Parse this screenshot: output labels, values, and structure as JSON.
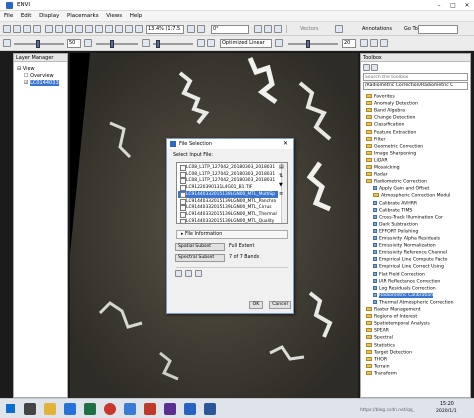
{
  "window": {
    "title": "ENVI",
    "min": "–",
    "max": "□",
    "close": "✕"
  },
  "menu": [
    "File",
    "Edit",
    "Display",
    "Placemarks",
    "Views",
    "Help"
  ],
  "toolbar": {
    "zoom": "13.4% (1:7.5",
    "rotation": "0°",
    "contrast_value": "50",
    "vectors_label": "Vectors",
    "annotations_label": "Annotations",
    "goto_label": "Go To",
    "goto_value": "",
    "interp": "Optimized Linear",
    "stretch_value": "20"
  },
  "layer_manager": {
    "title": "Layer Manager",
    "items": [
      "View",
      "Overview",
      "LC0144033"
    ]
  },
  "toolbox": {
    "title": "Toolbox",
    "search_placeholder": "Search the toolbox",
    "path": "/Radiometric Correction/Radiometric C",
    "items": [
      {
        "label": "Favorites",
        "kind": "folder",
        "level": 0
      },
      {
        "label": "Anomaly Detection",
        "kind": "folder",
        "level": 0
      },
      {
        "label": "Band Algebra",
        "kind": "folder",
        "level": 0
      },
      {
        "label": "Change Detection",
        "kind": "folder",
        "level": 0
      },
      {
        "label": "Classification",
        "kind": "folder",
        "level": 0
      },
      {
        "label": "Feature Extraction",
        "kind": "folder",
        "level": 0
      },
      {
        "label": "Filter",
        "kind": "folder",
        "level": 0
      },
      {
        "label": "Geometric Correction",
        "kind": "folder",
        "level": 0
      },
      {
        "label": "Image Sharpening",
        "kind": "folder",
        "level": 0
      },
      {
        "label": "LiDAR",
        "kind": "folder",
        "level": 0
      },
      {
        "label": "Mosaicking",
        "kind": "folder",
        "level": 0
      },
      {
        "label": "Radar",
        "kind": "folder",
        "level": 0
      },
      {
        "label": "Radiometric Correction",
        "kind": "folder",
        "level": 0
      },
      {
        "label": "Apply Gain and Offset",
        "kind": "tool",
        "level": 1
      },
      {
        "label": "Atmospheric Correction Modul",
        "kind": "folder",
        "level": 1
      },
      {
        "label": "Calibrate AVHRR",
        "kind": "tool",
        "level": 1
      },
      {
        "label": "Calibrate TIMS",
        "kind": "tool",
        "level": 1
      },
      {
        "label": "Cross-Track Illumination Cor",
        "kind": "tool",
        "level": 1
      },
      {
        "label": "Dark Subtraction",
        "kind": "tool",
        "level": 1
      },
      {
        "label": "EFFORT Polishing",
        "kind": "tool",
        "level": 1
      },
      {
        "label": "Emissivity Alpha Residuals",
        "kind": "tool",
        "level": 1
      },
      {
        "label": "Emissivity Normalization",
        "kind": "tool",
        "level": 1
      },
      {
        "label": "Emissivity Reference Channel",
        "kind": "tool",
        "level": 1
      },
      {
        "label": "Empirical Line Compute Facto",
        "kind": "tool",
        "level": 1
      },
      {
        "label": "Empirical Line Correct Using",
        "kind": "tool",
        "level": 1
      },
      {
        "label": "Flat Field Correction",
        "kind": "tool",
        "level": 1
      },
      {
        "label": "IAR Reflectance Correction",
        "kind": "tool",
        "level": 1
      },
      {
        "label": "Log Residuals Correction",
        "kind": "tool",
        "level": 1
      },
      {
        "label": "Radiometric Calibration",
        "kind": "tool",
        "level": 1,
        "selected": true
      },
      {
        "label": "Thermal Atmospheric Correction",
        "kind": "tool",
        "level": 1
      },
      {
        "label": "Raster Management",
        "kind": "folder",
        "level": 0
      },
      {
        "label": "Regions of Interest",
        "kind": "folder",
        "level": 0
      },
      {
        "label": "Spatiotemporal Analysis",
        "kind": "folder",
        "level": 0
      },
      {
        "label": "SPEAR",
        "kind": "folder",
        "level": 0
      },
      {
        "label": "Spectral",
        "kind": "folder",
        "level": 0
      },
      {
        "label": "Statistics",
        "kind": "folder",
        "level": 0
      },
      {
        "label": "Target Detection",
        "kind": "folder",
        "level": 0
      },
      {
        "label": "THOR",
        "kind": "folder",
        "level": 0
      },
      {
        "label": "Terrain",
        "kind": "folder",
        "level": 0
      },
      {
        "label": "Transform",
        "kind": "folder",
        "level": 0
      }
    ]
  },
  "dialog": {
    "title": "File Selection",
    "select_label": "Select Input File:",
    "files": [
      "LC08_L1TP_127042_20180303_2018031",
      "LC08_L1TP_127042_20180303_2018031",
      "LC08_L1TP_127042_20180303_2018031",
      "LC91220390131L4G01_B1.TIF",
      "LC91440332015139LGN00_MTL_MultiSp",
      "LC91440332015139LGN00_MTL_Panchro",
      "LC91440332015139LGN00_MTL_Cirrus",
      "LC91440332015139LGN00_MTL_Thermal",
      "LC91440332015139LGN00_MTL_Quality"
    ],
    "selected_index": 4,
    "file_info_label": "File Information",
    "spatial_label": "Spatial Subset",
    "spatial_value": "Full Extent",
    "spectral_label": "Spectral Subset",
    "spectral_value": "7 of 7 Bands",
    "ok": "OK",
    "cancel": "Cancel"
  },
  "taskbar": {
    "time": "15:20",
    "date": "2020/1/1",
    "watermark": "https://blog.csdn.net/qq_"
  }
}
